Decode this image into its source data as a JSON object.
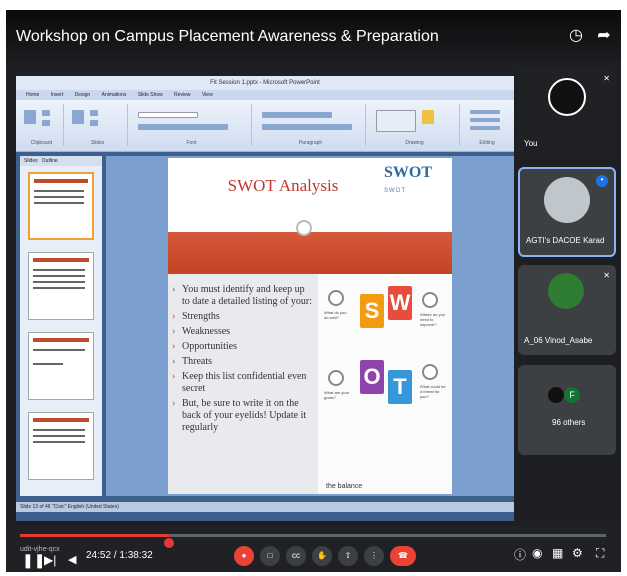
{
  "header": {
    "title": "Workshop on Campus Placement Awareness & Preparation",
    "clock_icon": "clock-icon",
    "share_icon": "share-arrow-icon"
  },
  "ppt": {
    "window_title": "Fit Session 1.pptx - Microsoft PowerPoint",
    "tabs": [
      "Home",
      "Insert",
      "Design",
      "Animations",
      "Slide Show",
      "Review",
      "View"
    ],
    "ribbon_groups": [
      "Clipboard",
      "Slides",
      "Font",
      "Paragraph",
      "Drawing",
      "Editing"
    ],
    "side_tabs": [
      "Slides",
      "Outline"
    ],
    "status": "Slide 13 of 46   \"Civic\"   English (United States)",
    "slide": {
      "title": "SWOT Analysis",
      "logo": "SWOT",
      "logo_mini": "SWOT",
      "bullets": [
        "You must identify and keep up to date a detailed listing of your:",
        "Strengths",
        "Weaknesses",
        "Opportunities",
        "Threats",
        "Keep this list confidential even secret",
        "But, be sure to write it on the back of your eyelids! Update it regularly"
      ],
      "letters": [
        "S",
        "W",
        "O",
        "T"
      ],
      "notes": [
        "What do you do well?",
        "Where do you need to improve?",
        "What are your goals?",
        "What could be a threat for you?"
      ],
      "balance": "the balance"
    }
  },
  "participants": [
    {
      "name": "You",
      "type": "self"
    },
    {
      "name": "AGTI's DACOE Karad",
      "type": "speaker"
    },
    {
      "name": "A_06 Vinod_Asabe",
      "type": "participant"
    },
    {
      "name": "96 others",
      "initial": "F"
    }
  ],
  "controls": {
    "time": "24:52 / 1:38:32",
    "progress": 0.254,
    "udit": "udit-vjhe-qcx"
  },
  "colors": {
    "brand_red": "#e53935",
    "slide_red": "#c14425",
    "swot_s": "#f39c12",
    "swot_w": "#e74c3c",
    "swot_o": "#8e44ad",
    "swot_t": "#3498db"
  }
}
